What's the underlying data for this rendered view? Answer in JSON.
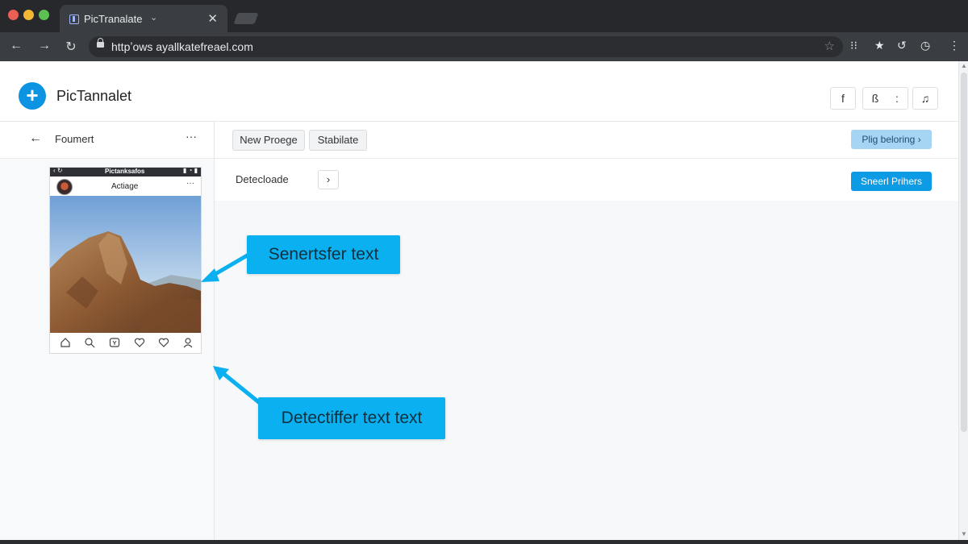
{
  "browser": {
    "tab_title": "PicTranalate",
    "url": "httpʼows ayallkatefreael.com"
  },
  "app": {
    "name": "PicTannalet",
    "header_buttons": [
      "f",
      "ß",
      ":",
      "♫"
    ]
  },
  "sidebar": {
    "title": "Foumert",
    "more": "···"
  },
  "phone_preview": {
    "status_title": "Pictanksafos",
    "post_title": "Actiage",
    "more": "···"
  },
  "toolbar": {
    "new_project": "New Proege",
    "stabilate": "Stabilate",
    "accent_button": "Plig beloring ›"
  },
  "row2": {
    "label": "Detecloade",
    "chevron": "›",
    "primary_button": "Sneerl Prihers"
  },
  "callouts": {
    "top": "Senertsfer text",
    "bottom": "Detectiffer text text"
  },
  "colors": {
    "accent": "#0ab0ef",
    "primary_button": "#0d9be6",
    "logo": "#0c93e2"
  }
}
